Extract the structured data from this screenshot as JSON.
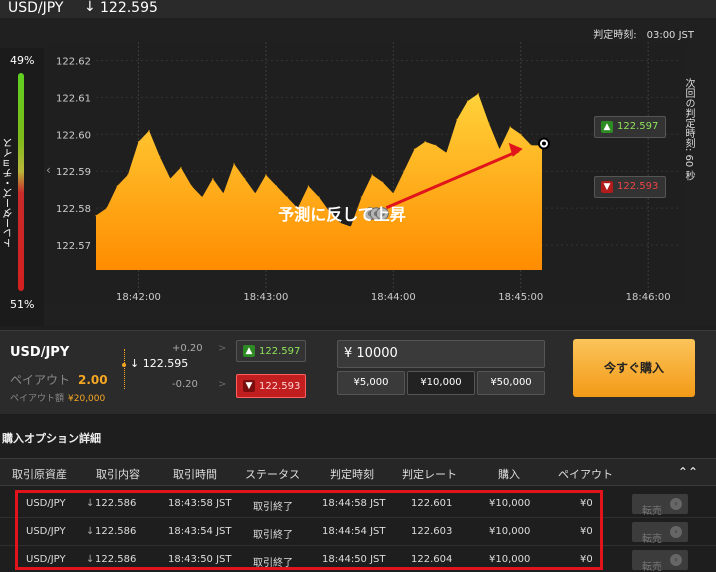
{
  "header": {
    "symbol": "USD/JPY",
    "arrow": "↓",
    "rate": "122.595"
  },
  "chart": {
    "judge_label": "判定時刻:",
    "judge_time": "03:00 JST",
    "trader_choice_label": "トレーダーズ・チョイス",
    "trader_top_pct": "49%",
    "trader_bottom_pct": "51%",
    "countdown_label": "次回の判定時刻: 60 秒",
    "annotation": "予測に反して上昇",
    "up_button": "122.597",
    "down_button": "122.593",
    "colors": {
      "fill_top": "#ff8c00",
      "fill_bottom": "#ffd23a",
      "arrow": "#e0141a"
    }
  },
  "chart_data": {
    "type": "area",
    "title": "",
    "xlabel": "",
    "ylabel": "",
    "x_ticks": [
      "18:42:00",
      "18:43:00",
      "18:44:00",
      "18:45:00",
      "18:46:00"
    ],
    "y_ticks": [
      "122.62",
      "122.61",
      "122.60",
      "122.59",
      "122.58",
      "122.57"
    ],
    "ylim": [
      122.56,
      122.625
    ],
    "series": [
      {
        "x": [
          "18:41:40",
          "18:41:45",
          "18:41:50",
          "18:41:55",
          "18:42:00",
          "18:42:05",
          "18:42:10",
          "18:42:15",
          "18:42:20",
          "18:42:25",
          "18:42:30",
          "18:42:35",
          "18:42:40",
          "18:42:45",
          "18:42:50",
          "18:42:55",
          "18:43:00",
          "18:43:05",
          "18:43:10",
          "18:43:15",
          "18:43:20",
          "18:43:25",
          "18:43:30",
          "18:43:35",
          "18:43:40",
          "18:43:45",
          "18:43:50",
          "18:43:55",
          "18:44:00",
          "18:44:05",
          "18:44:10",
          "18:44:15",
          "18:44:20",
          "18:44:25",
          "18:44:30",
          "18:44:35",
          "18:44:40",
          "18:44:45",
          "18:44:50",
          "18:44:55",
          "18:45:00",
          "18:45:05",
          "18:45:10"
        ],
        "values": [
          122.578,
          122.58,
          122.586,
          122.589,
          122.598,
          122.601,
          122.594,
          122.588,
          122.591,
          122.586,
          122.583,
          122.588,
          122.584,
          122.592,
          122.588,
          122.584,
          122.589,
          122.586,
          122.583,
          122.58,
          122.586,
          122.583,
          122.579,
          122.576,
          122.575,
          122.583,
          122.589,
          122.587,
          122.584,
          122.59,
          122.596,
          122.598,
          122.597,
          122.595,
          122.604,
          122.609,
          122.611,
          122.603,
          122.596,
          122.602,
          122.6,
          122.597,
          122.597
        ]
      }
    ],
    "grid": true,
    "legend": "none"
  },
  "trade": {
    "symbol": "USD/JPY",
    "payout_label": "ペイアウト",
    "payout_value": "2.00",
    "payout_amount_label": "ペイアウト額",
    "payout_amount_value": "¥20,000",
    "plus_label": "+0.20",
    "minus_label": "-0.20",
    "mid_arrow": "↓",
    "mid_rate": "122.595",
    "up_rate": "122.597",
    "down_rate": "122.593",
    "amount_value": "¥ 10000",
    "presets": [
      "¥5,000",
      "¥10,000",
      "¥50,000"
    ],
    "buy_now": "今すぐ購入"
  },
  "details": {
    "title": "購入オプション詳細",
    "columns": [
      "取引原資産",
      "取引内容",
      "取引時間",
      "ステータス",
      "判定時刻",
      "判定レート",
      "購入",
      "ペイアウト"
    ],
    "rows": [
      {
        "asset": "USD/JPY",
        "arrow": "↓",
        "content": "122.586",
        "time": "18:43:58 JST",
        "status": "取引終了",
        "judge": "18:44:58 JST",
        "rate": "122.601",
        "buy": "¥10,000",
        "payout": "¥0",
        "sell": "転売"
      },
      {
        "asset": "USD/JPY",
        "arrow": "↓",
        "content": "122.586",
        "time": "18:43:54 JST",
        "status": "取引終了",
        "judge": "18:44:54 JST",
        "rate": "122.603",
        "buy": "¥10,000",
        "payout": "¥0",
        "sell": "転売"
      },
      {
        "asset": "USD/JPY",
        "arrow": "↓",
        "content": "122.586",
        "time": "18:43:50 JST",
        "status": "取引終了",
        "judge": "18:44:50 JST",
        "rate": "122.604",
        "buy": "¥10,000",
        "payout": "¥0",
        "sell": "転売"
      }
    ]
  }
}
